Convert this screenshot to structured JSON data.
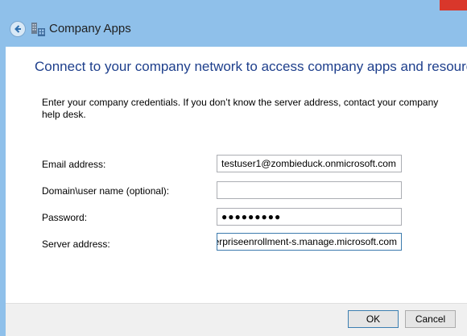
{
  "window": {
    "title": "Company Apps"
  },
  "main": {
    "heading": "Connect to your company network to access company apps and resources",
    "instructions": "Enter your company credentials. If you don’t know the server address, contact your company help desk."
  },
  "form": {
    "email_label": "Email address:",
    "email_value": "testuser1@zombieduck.onmicrosoft.com",
    "domain_label": "Domain\\user name (optional):",
    "domain_value": "",
    "password_label": "Password:",
    "password_value": "●●●●●●●●●",
    "server_label": "Server address:",
    "server_value": "enterpriseenrollment-s.manage.microsoft.com"
  },
  "footer": {
    "ok_label": "OK",
    "cancel_label": "Cancel"
  },
  "colors": {
    "frame": "#8fc0ea",
    "heading": "#1e3f8c",
    "close_button": "#d9372b"
  },
  "icons": {
    "back": "back-arrow-icon",
    "app": "company-apps-icon"
  }
}
